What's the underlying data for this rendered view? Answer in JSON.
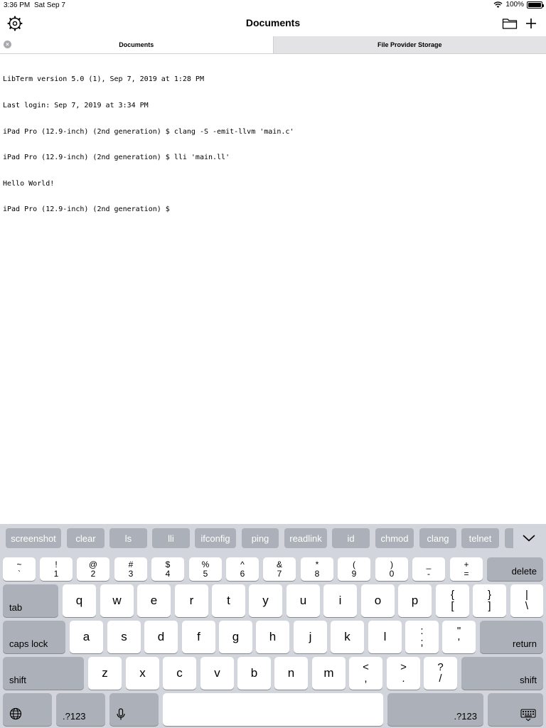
{
  "status": {
    "time": "3:36 PM",
    "date": "Sat Sep 7",
    "battery": "100%",
    "battery_level": 1.0
  },
  "nav": {
    "title": "Documents",
    "left_icon": "gear-icon",
    "right_icons": [
      "folder-icon",
      "plus-icon"
    ]
  },
  "tabs": [
    {
      "label": "Documents",
      "active": true,
      "close_icon": "close-icon"
    },
    {
      "label": "File Provider Storage",
      "active": false
    }
  ],
  "terminal": {
    "lines": [
      "LibTerm version 5.0 (1), Sep 7, 2019 at 1:28 PM",
      "Last login: Sep 7, 2019 at 3:34 PM",
      "iPad Pro (12.9-inch) (2nd generation) $ clang -S -emit-llvm 'main.c'",
      "iPad Pro (12.9-inch) (2nd generation) $ lli 'main.ll'",
      "Hello World!",
      "iPad Pro (12.9-inch) (2nd generation) $"
    ]
  },
  "shortcuts": [
    "screenshot",
    "clear",
    "ls",
    "lli",
    "ifconfig",
    "ping",
    "readlink",
    "id",
    "chmod",
    "clang",
    "telnet"
  ],
  "keyboard": {
    "number_row": [
      {
        "top": "~",
        "bottom": "`"
      },
      {
        "top": "!",
        "bottom": "1"
      },
      {
        "top": "@",
        "bottom": "2"
      },
      {
        "top": "#",
        "bottom": "3"
      },
      {
        "top": "$",
        "bottom": "4"
      },
      {
        "top": "%",
        "bottom": "5"
      },
      {
        "top": "^",
        "bottom": "6"
      },
      {
        "top": "&",
        "bottom": "7"
      },
      {
        "top": "*",
        "bottom": "8"
      },
      {
        "top": "(",
        "bottom": "9"
      },
      {
        "top": ")",
        "bottom": "0"
      },
      {
        "top": "_",
        "bottom": "-"
      },
      {
        "top": "+",
        "bottom": "="
      }
    ],
    "delete": "delete",
    "tab": "tab",
    "row_q": [
      "q",
      "w",
      "e",
      "r",
      "t",
      "y",
      "u",
      "i",
      "o",
      "p"
    ],
    "row_q_extra": [
      {
        "top": "{",
        "bottom": "["
      },
      {
        "top": "}",
        "bottom": "]"
      },
      {
        "top": "|",
        "bottom": "\\"
      }
    ],
    "caps_lock": "caps lock",
    "row_a": [
      "a",
      "s",
      "d",
      "f",
      "g",
      "h",
      "j",
      "k",
      "l"
    ],
    "row_a_extra": [
      {
        "top": ":",
        "bottom": ";"
      },
      {
        "top": "\"",
        "bottom": "'"
      }
    ],
    "return": "return",
    "shift": "shift",
    "row_z": [
      "z",
      "x",
      "c",
      "v",
      "b",
      "n",
      "m"
    ],
    "row_z_extra": [
      {
        "top": "<",
        "bottom": ","
      },
      {
        "top": ">",
        "bottom": "."
      },
      {
        "top": "?",
        "bottom": "/"
      }
    ],
    "numbers_key": ".?123",
    "globe_icon": "globe-icon",
    "mic_icon": "microphone-icon",
    "hide_keyboard_icon": "keyboard-hide-icon",
    "chevron_icon": "chevron-down-icon"
  }
}
